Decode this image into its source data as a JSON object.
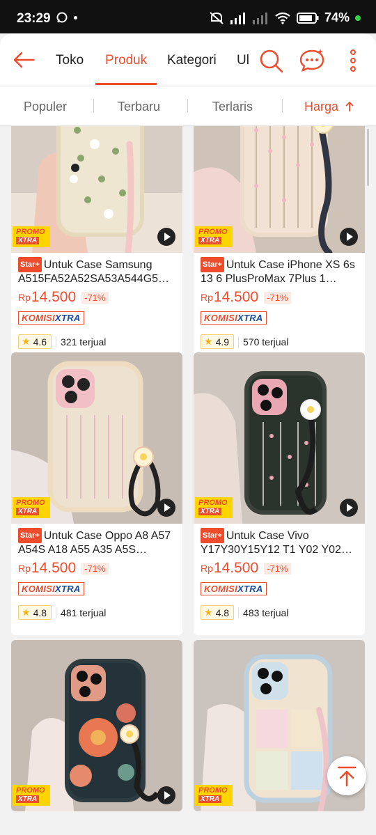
{
  "status": {
    "time": "23:29",
    "battery": "74%"
  },
  "nav": {
    "tabs": [
      {
        "label": "Toko"
      },
      {
        "label": "Produk"
      },
      {
        "label": "Kategori"
      },
      {
        "label": "Ul"
      }
    ],
    "active_tab": "Produk"
  },
  "sort": {
    "options": [
      "Populer",
      "Terbaru",
      "Terlaris",
      "Harga"
    ],
    "active": "Harga",
    "price_sort_icon": "arrow-up-icon"
  },
  "products": [
    {
      "badge": "Star+",
      "title": "Untuk Case Samsung A515FA52A52SA53A544G5…",
      "currency": "Rp",
      "price": "14.500",
      "discount": "-71%",
      "komisi": "KOMISI",
      "komisi_x": "XTRA",
      "rating": "4.6",
      "sold": "321 terjual",
      "promo_1": "PROMO",
      "promo_2": "XTRA"
    },
    {
      "badge": "Star+",
      "title": "Untuk Case iPhone XS 6s 13 6 PlusProMax 7Plus 1…",
      "currency": "Rp",
      "price": "14.500",
      "discount": "-71%",
      "komisi": "KOMISI",
      "komisi_x": "XTRA",
      "rating": "4.9",
      "sold": "570 terjual",
      "promo_1": "PROMO",
      "promo_2": "XTRA"
    },
    {
      "badge": "Star+",
      "title": "Untuk Case Oppo A8 A57 A54S A18 A55 A35 A5S…",
      "currency": "Rp",
      "price": "14.500",
      "discount": "-71%",
      "komisi": "KOMISI",
      "komisi_x": "XTRA",
      "rating": "4.8",
      "sold": "481 terjual",
      "promo_1": "PROMO",
      "promo_2": "XTRA"
    },
    {
      "badge": "Star+",
      "title": "Untuk Case Vivo Y17Y30Y15Y12 T1 Y02 Y02…",
      "currency": "Rp",
      "price": "14.500",
      "discount": "-71%",
      "komisi": "KOMISI",
      "komisi_x": "XTRA",
      "rating": "4.8",
      "sold": "483 terjual",
      "promo_1": "PROMO",
      "promo_2": "XTRA"
    },
    {
      "promo_1": "PROMO",
      "promo_2": "XTRA"
    },
    {
      "promo_1": "PROMO",
      "promo_2": "XTRA"
    }
  ],
  "colors": {
    "accent": "#ee4d2d",
    "promo_yellow": "#ffd400",
    "star": "#f7b500"
  }
}
